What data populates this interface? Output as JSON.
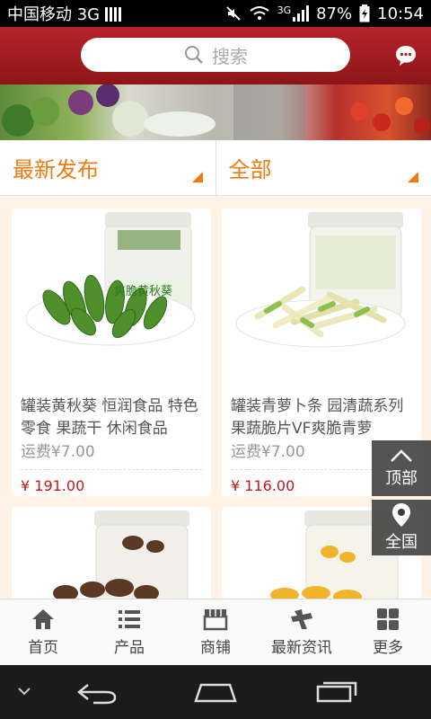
{
  "status_bar": {
    "carrier": "中国移动 3G",
    "network": "3G",
    "battery": "87%",
    "time": "10:54"
  },
  "header": {
    "search_placeholder": "搜索",
    "chat_icon": "chat-bubble-icon"
  },
  "filters": [
    {
      "label": "最新发布"
    },
    {
      "label": "全部"
    }
  ],
  "products": [
    {
      "title": "罐装黄秋葵 恒润食品 特色零食 果蔬干 休闲食品",
      "shipping": "运费¥7.00",
      "price": "¥ 191.00",
      "jar_label": "爽脆黄秋葵"
    },
    {
      "title": "罐装青萝卜条 园清蔬系列果蔬脆片VF爽脆青萝",
      "shipping": "运费¥7.00",
      "price": "¥ 116.00"
    },
    {
      "title": "",
      "shipping": "",
      "price": ""
    },
    {
      "title": "",
      "shipping": "",
      "price": ""
    }
  ],
  "floating": {
    "top_label": "顶部",
    "region_label": "全国"
  },
  "bottom_nav": [
    {
      "label": "首页",
      "icon": "home-icon"
    },
    {
      "label": "产品",
      "icon": "list-icon"
    },
    {
      "label": "商铺",
      "icon": "store-icon"
    },
    {
      "label": "最新资讯",
      "icon": "news-icon"
    },
    {
      "label": "更多",
      "icon": "grid-icon"
    }
  ],
  "colors": {
    "header_red": "#a91e24",
    "accent_orange": "#f07a12",
    "price_red": "#c8161d"
  }
}
